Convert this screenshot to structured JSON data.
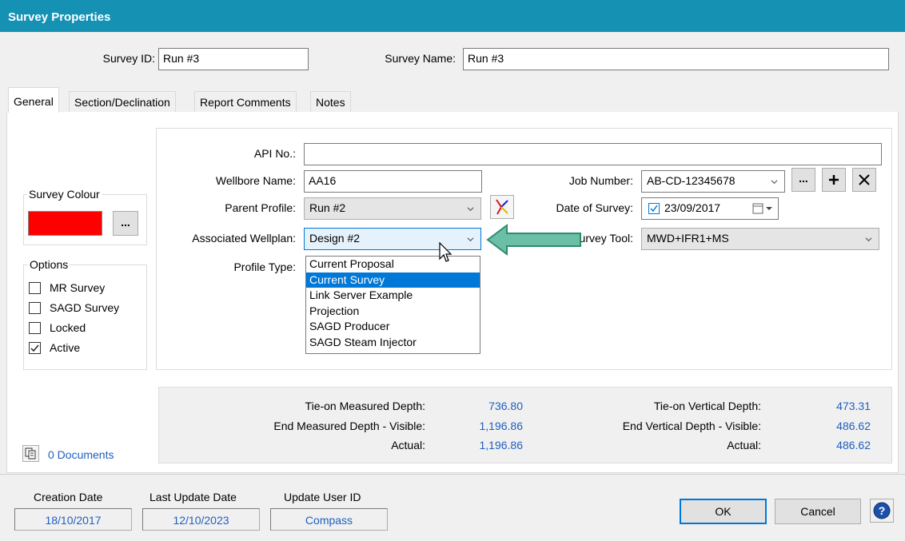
{
  "window": {
    "title": "Survey Properties",
    "accent": "#1591b3"
  },
  "header": {
    "survey_id_label": "Survey ID:",
    "survey_id_value": "Run #3",
    "survey_name_label": "Survey Name:",
    "survey_name_value": "Run #3"
  },
  "tabs": [
    {
      "label": "General",
      "active": true
    },
    {
      "label": "Section/Declination",
      "active": false
    },
    {
      "label": "Report Comments",
      "active": false
    },
    {
      "label": "Notes",
      "active": false
    }
  ],
  "survey_colour": {
    "label": "Survey Colour",
    "value": "#ff0000",
    "browse_label": "..."
  },
  "options": {
    "label": "Options",
    "items": [
      {
        "label": "MR Survey",
        "checked": false
      },
      {
        "label": "SAGD Survey",
        "checked": false
      },
      {
        "label": "Locked",
        "checked": false
      },
      {
        "label": "Active",
        "checked": true
      }
    ]
  },
  "form": {
    "api_no_label": "API No.:",
    "api_no_value": "",
    "wellbore_name_label": "Wellbore Name:",
    "wellbore_name_value": "AA16",
    "parent_profile_label": "Parent Profile:",
    "parent_profile_value": "Run #2",
    "associated_wellplan_label": "Associated Wellplan:",
    "associated_wellplan_value": "Design #2",
    "profile_type_label": "Profile Type:",
    "job_number_label": "Job Number:",
    "job_number_value": "AB-CD-12345678",
    "job_browse_label": "...",
    "date_of_survey_label": "Date of Survey:",
    "date_of_survey_value": "23/09/2017",
    "survey_tool_label": "urvey Tool:",
    "survey_tool_value": "MWD+IFR1+MS"
  },
  "profile_type_options": [
    {
      "label": "Current Proposal",
      "selected": false
    },
    {
      "label": "Current Survey",
      "selected": true
    },
    {
      "label": "Link Server Example",
      "selected": false
    },
    {
      "label": "Projection",
      "selected": false
    },
    {
      "label": "SAGD Producer",
      "selected": false
    },
    {
      "label": "SAGD Steam Injector",
      "selected": false
    }
  ],
  "depths": {
    "tie_on_md_label": "Tie-on Measured Depth:",
    "tie_on_md_value": "736.80",
    "end_md_visible_label": "End Measured Depth - Visible:",
    "end_md_visible_value": "1,196.86",
    "md_actual_label": "Actual:",
    "md_actual_value": "1,196.86",
    "tie_on_vd_label": "Tie-on Vertical Depth:",
    "tie_on_vd_value": "473.31",
    "end_vd_visible_label": "End Vertical Depth - Visible:",
    "end_vd_visible_value": "486.62",
    "vd_actual_label": "Actual:",
    "vd_actual_value": "486.62"
  },
  "documents": {
    "label": "0 Documents"
  },
  "footer": {
    "creation_date_label": "Creation Date",
    "creation_date_value": "18/10/2017",
    "last_update_label": "Last Update Date",
    "last_update_value": "12/10/2023",
    "update_user_label": "Update User ID",
    "update_user_value": "Compass",
    "ok_label": "OK",
    "cancel_label": "Cancel"
  }
}
